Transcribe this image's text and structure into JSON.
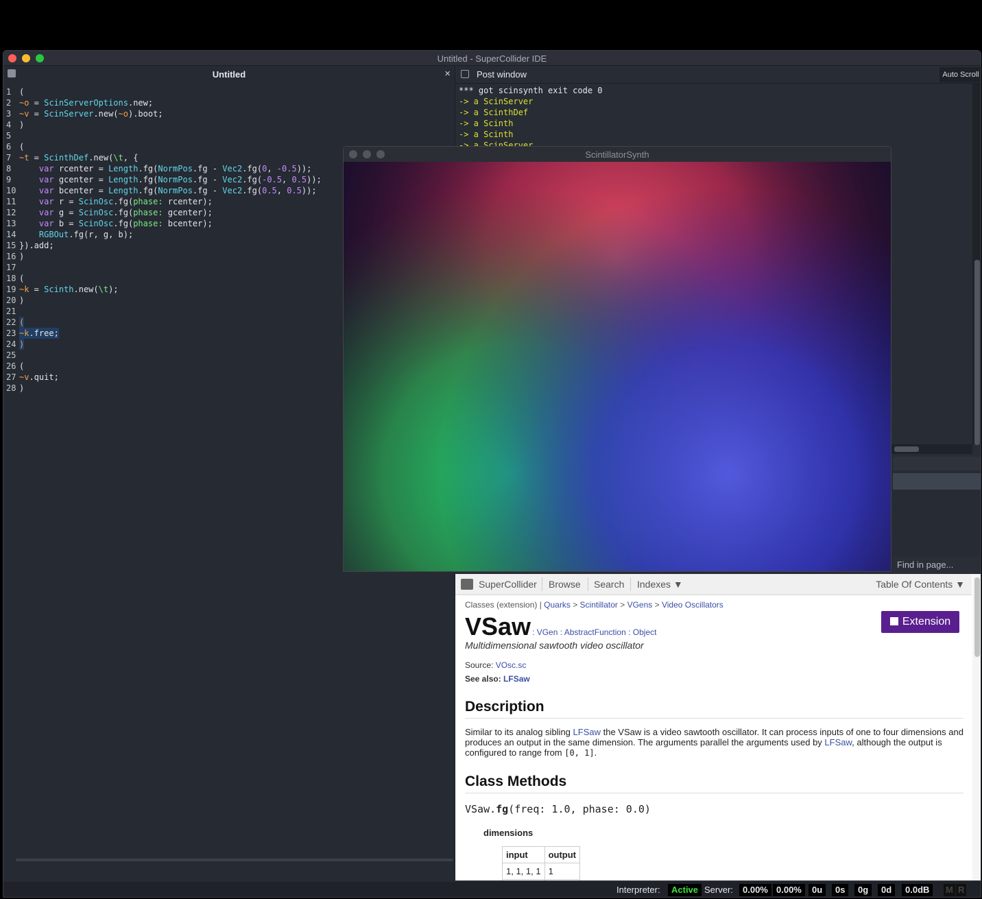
{
  "window": {
    "title": "Untitled - SuperCollider IDE"
  },
  "editor": {
    "tab_title": "Untitled",
    "close_glyph": "×",
    "lines": [
      [
        [
          "w",
          "("
        ]
      ],
      [
        [
          "g",
          "~o"
        ],
        [
          "w",
          " = "
        ],
        [
          "k",
          "ScinServerOptions"
        ],
        [
          "w",
          ".new;"
        ]
      ],
      [
        [
          "g",
          "~v"
        ],
        [
          "w",
          " = "
        ],
        [
          "k",
          "ScinServer"
        ],
        [
          "w",
          ".new("
        ],
        [
          "g",
          "~o"
        ],
        [
          "w",
          ").boot;"
        ]
      ],
      [
        [
          "w",
          ")"
        ]
      ],
      [],
      [
        [
          "w",
          "("
        ]
      ],
      [
        [
          "g",
          "~t"
        ],
        [
          "w",
          " = "
        ],
        [
          "k",
          "ScinthDef"
        ],
        [
          "w",
          ".new("
        ],
        [
          "s",
          "\\t"
        ],
        [
          "w",
          ", {"
        ]
      ],
      [
        [
          "w",
          "    "
        ],
        [
          "p",
          "var"
        ],
        [
          "w",
          " rcenter = "
        ],
        [
          "k",
          "Length"
        ],
        [
          "w",
          ".fg("
        ],
        [
          "k",
          "NormPos"
        ],
        [
          "w",
          ".fg - "
        ],
        [
          "k",
          "Vec2"
        ],
        [
          "w",
          ".fg("
        ],
        [
          "n",
          "0"
        ],
        [
          "w",
          ", "
        ],
        [
          "n",
          "-0.5"
        ],
        [
          "w",
          "));"
        ]
      ],
      [
        [
          "w",
          "    "
        ],
        [
          "p",
          "var"
        ],
        [
          "w",
          " gcenter = "
        ],
        [
          "k",
          "Length"
        ],
        [
          "w",
          ".fg("
        ],
        [
          "k",
          "NormPos"
        ],
        [
          "w",
          ".fg - "
        ],
        [
          "k",
          "Vec2"
        ],
        [
          "w",
          ".fg("
        ],
        [
          "n",
          "-0.5"
        ],
        [
          "w",
          ", "
        ],
        [
          "n",
          "0.5"
        ],
        [
          "w",
          "));"
        ]
      ],
      [
        [
          "w",
          "    "
        ],
        [
          "p",
          "var"
        ],
        [
          "w",
          " bcenter = "
        ],
        [
          "k",
          "Length"
        ],
        [
          "w",
          ".fg("
        ],
        [
          "k",
          "NormPos"
        ],
        [
          "w",
          ".fg - "
        ],
        [
          "k",
          "Vec2"
        ],
        [
          "w",
          ".fg("
        ],
        [
          "n",
          "0.5"
        ],
        [
          "w",
          ", "
        ],
        [
          "n",
          "0.5"
        ],
        [
          "w",
          "));"
        ]
      ],
      [
        [
          "w",
          "    "
        ],
        [
          "p",
          "var"
        ],
        [
          "w",
          " r = "
        ],
        [
          "k",
          "ScinOsc"
        ],
        [
          "w",
          ".fg("
        ],
        [
          "s",
          "phase:"
        ],
        [
          "w",
          " rcenter);"
        ]
      ],
      [
        [
          "w",
          "    "
        ],
        [
          "p",
          "var"
        ],
        [
          "w",
          " g = "
        ],
        [
          "k",
          "ScinOsc"
        ],
        [
          "w",
          ".fg("
        ],
        [
          "s",
          "phase:"
        ],
        [
          "w",
          " gcenter);"
        ]
      ],
      [
        [
          "w",
          "    "
        ],
        [
          "p",
          "var"
        ],
        [
          "w",
          " b = "
        ],
        [
          "k",
          "ScinOsc"
        ],
        [
          "w",
          ".fg("
        ],
        [
          "s",
          "phase:"
        ],
        [
          "w",
          " bcenter);"
        ]
      ],
      [
        [
          "w",
          "    "
        ],
        [
          "k",
          "RGBOut"
        ],
        [
          "w",
          ".fg(r, g, b);"
        ]
      ],
      [
        [
          "w",
          "}).add;"
        ]
      ],
      [
        [
          "w",
          ")"
        ]
      ],
      [],
      [
        [
          "w",
          "("
        ]
      ],
      [
        [
          "g",
          "~k"
        ],
        [
          "w",
          " = "
        ],
        [
          "k",
          "Scinth"
        ],
        [
          "w",
          ".new("
        ],
        [
          "s",
          "\\t"
        ],
        [
          "w",
          ");"
        ]
      ],
      [
        [
          "w",
          ")"
        ]
      ],
      [],
      [
        [
          "g",
          "("
        ]
      ],
      [
        [
          "g",
          "~k"
        ],
        [
          "w",
          ".free;"
        ]
      ],
      [
        [
          "g",
          ")"
        ]
      ],
      [],
      [
        [
          "w",
          "("
        ]
      ],
      [
        [
          "g",
          "~v"
        ],
        [
          "w",
          ".quit;"
        ]
      ],
      [
        [
          "w",
          ")"
        ]
      ]
    ],
    "selected_lines": [
      22,
      23,
      24
    ]
  },
  "post_window": {
    "title": "Post window",
    "auto_scroll_label": "Auto Scroll",
    "lines": [
      {
        "text": "*** got scinsynth exit code 0",
        "color": "#e6e8ec"
      },
      {
        "text": "-> a ScinServer",
        "color": "#d9e034"
      },
      {
        "text": "-> a ScinthDef",
        "color": "#d9e034"
      },
      {
        "text": "-> a Scinth",
        "color": "#d9e034"
      },
      {
        "text": "-> a Scinth",
        "color": "#d9e034"
      },
      {
        "text": "-> a ScinServer",
        "color": "#d9e034"
      }
    ]
  },
  "scintillator": {
    "title": "ScintillatorSynth"
  },
  "find": {
    "placeholder": "Find in page..."
  },
  "help": {
    "nav": {
      "home": "SuperCollider",
      "browse": "Browse",
      "search": "Search",
      "indexes": "Indexes ▼",
      "toc": "Table Of Contents ▼"
    },
    "breadcrumb": {
      "prefix": "Classes (extension) | ",
      "quarks": "Quarks",
      "scintillator": "Scintillator",
      "vgens": "VGens",
      "video_osc": "Video Oscillators",
      "sep": " > "
    },
    "class_name": "VSaw",
    "inheritance": ": VGen : AbstractFunction : Object",
    "summary": "Multidimensional sawtooth video oscillator",
    "source_label": "Source: ",
    "source_file": "VOsc.sc",
    "see_also_label": "See also: ",
    "see_also_link": "LFSaw",
    "extension_label": "Extension",
    "description_heading": "Description",
    "description": {
      "p1": "Similar to its analog sibling ",
      "link1": "LFSaw",
      "p2": " the VSaw is a video sawtooth oscillator. It can process inputs of one to four dimensions and produces an output in the same dimension. The arguments parallel the arguments used by ",
      "link2": "LFSaw",
      "p3": ", although the output is configured to range from ",
      "code": "[0, 1]",
      "p4": "."
    },
    "class_methods_heading": "Class Methods",
    "method_class": "VSaw.",
    "method_name": "fg",
    "method_args": "(freq: 1.0, phase: 0.0)",
    "dimensions_heading": "dimensions",
    "table": {
      "headers": [
        "input",
        "output"
      ],
      "rows": [
        [
          "1, 1, 1, 1",
          "1"
        ]
      ]
    }
  },
  "status": {
    "interpreter_label": "Interpreter:",
    "interpreter_state": "Active",
    "server_label": "Server:",
    "avg_cpu": "0.00%",
    "peak_cpu": "0.00%",
    "ugens": "0u",
    "synths": "0s",
    "groups": "0g",
    "synthdefs": "0d",
    "volume": "0.0dB",
    "mute": "M",
    "record": "R"
  }
}
